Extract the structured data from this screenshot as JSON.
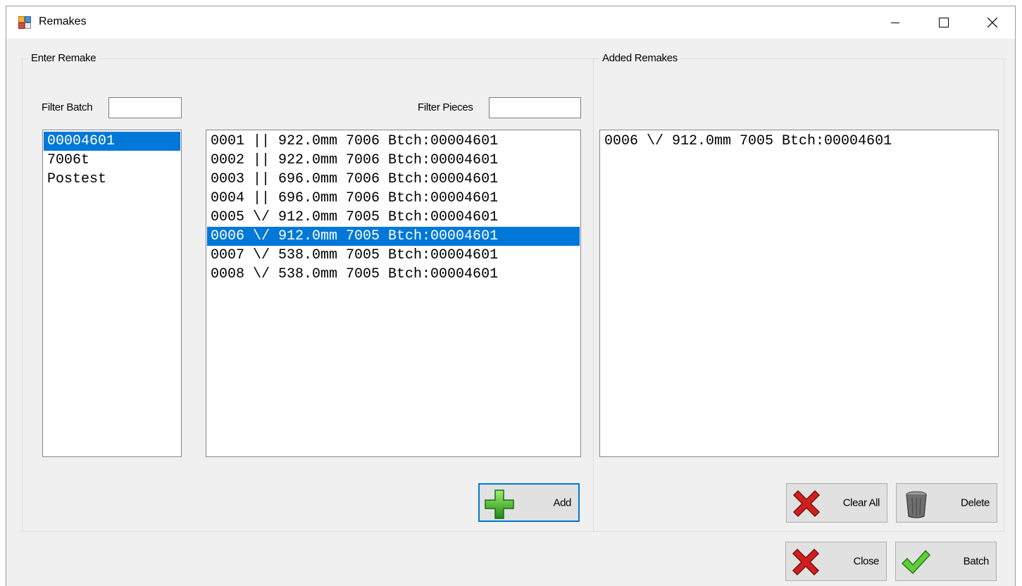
{
  "window": {
    "title": "Remakes"
  },
  "enter_remake": {
    "group_label": "Enter Remake",
    "filter_batch_label": "Filter Batch",
    "filter_batch_value": "",
    "filter_pieces_label": "Filter Pieces",
    "filter_pieces_value": "",
    "batches": [
      {
        "text": "00004601",
        "selected": true
      },
      {
        "text": "7006t",
        "selected": false
      },
      {
        "text": "Postest",
        "selected": false
      }
    ],
    "pieces": [
      {
        "text": "0001 || 922.0mm 7006 Btch:00004601",
        "selected": false
      },
      {
        "text": "0002 || 922.0mm 7006 Btch:00004601",
        "selected": false
      },
      {
        "text": "0003 || 696.0mm 7006 Btch:00004601",
        "selected": false
      },
      {
        "text": "0004 || 696.0mm 7006 Btch:00004601",
        "selected": false
      },
      {
        "text": "0005 \\/ 912.0mm 7005 Btch:00004601",
        "selected": false
      },
      {
        "text": "0006 \\/ 912.0mm 7005 Btch:00004601",
        "selected": true
      },
      {
        "text": "0007 \\/ 538.0mm 7005 Btch:00004601",
        "selected": false
      },
      {
        "text": "0008 \\/ 538.0mm 7005 Btch:00004601",
        "selected": false
      }
    ],
    "add_label": "Add"
  },
  "added_remakes": {
    "group_label": "Added Remakes",
    "items": [
      {
        "text": "0006 \\/ 912.0mm 7005 Btch:00004601",
        "selected": false
      }
    ],
    "clear_all_label": "Clear All",
    "delete_label": "Delete"
  },
  "footer": {
    "close_label": "Close",
    "batch_label": "Batch"
  },
  "colors": {
    "selection": "#0078d7",
    "form_bg": "#f0f0f0",
    "button_bg": "#e1e1e1"
  }
}
